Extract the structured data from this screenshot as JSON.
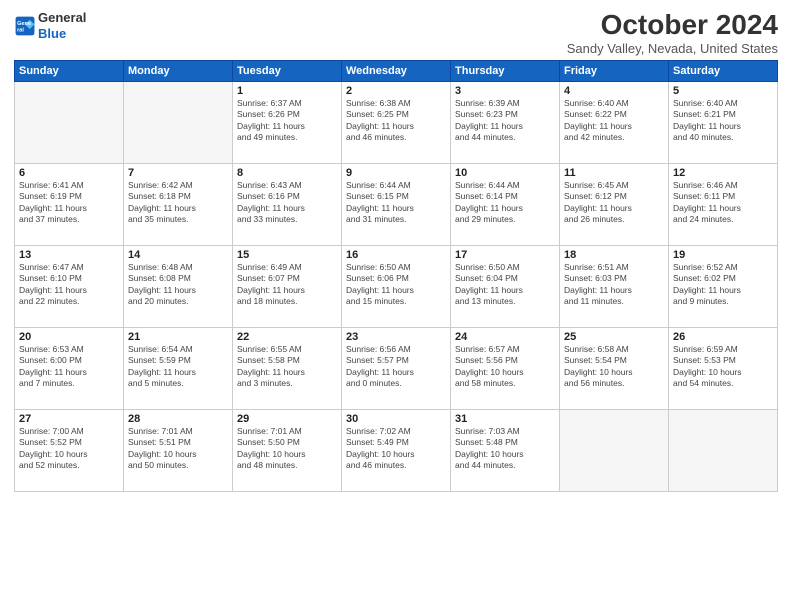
{
  "header": {
    "logo_line1": "General",
    "logo_line2": "Blue",
    "month": "October 2024",
    "location": "Sandy Valley, Nevada, United States"
  },
  "weekdays": [
    "Sunday",
    "Monday",
    "Tuesday",
    "Wednesday",
    "Thursday",
    "Friday",
    "Saturday"
  ],
  "weeks": [
    [
      {
        "day": "",
        "detail": ""
      },
      {
        "day": "",
        "detail": ""
      },
      {
        "day": "1",
        "detail": "Sunrise: 6:37 AM\nSunset: 6:26 PM\nDaylight: 11 hours\nand 49 minutes."
      },
      {
        "day": "2",
        "detail": "Sunrise: 6:38 AM\nSunset: 6:25 PM\nDaylight: 11 hours\nand 46 minutes."
      },
      {
        "day": "3",
        "detail": "Sunrise: 6:39 AM\nSunset: 6:23 PM\nDaylight: 11 hours\nand 44 minutes."
      },
      {
        "day": "4",
        "detail": "Sunrise: 6:40 AM\nSunset: 6:22 PM\nDaylight: 11 hours\nand 42 minutes."
      },
      {
        "day": "5",
        "detail": "Sunrise: 6:40 AM\nSunset: 6:21 PM\nDaylight: 11 hours\nand 40 minutes."
      }
    ],
    [
      {
        "day": "6",
        "detail": "Sunrise: 6:41 AM\nSunset: 6:19 PM\nDaylight: 11 hours\nand 37 minutes."
      },
      {
        "day": "7",
        "detail": "Sunrise: 6:42 AM\nSunset: 6:18 PM\nDaylight: 11 hours\nand 35 minutes."
      },
      {
        "day": "8",
        "detail": "Sunrise: 6:43 AM\nSunset: 6:16 PM\nDaylight: 11 hours\nand 33 minutes."
      },
      {
        "day": "9",
        "detail": "Sunrise: 6:44 AM\nSunset: 6:15 PM\nDaylight: 11 hours\nand 31 minutes."
      },
      {
        "day": "10",
        "detail": "Sunrise: 6:44 AM\nSunset: 6:14 PM\nDaylight: 11 hours\nand 29 minutes."
      },
      {
        "day": "11",
        "detail": "Sunrise: 6:45 AM\nSunset: 6:12 PM\nDaylight: 11 hours\nand 26 minutes."
      },
      {
        "day": "12",
        "detail": "Sunrise: 6:46 AM\nSunset: 6:11 PM\nDaylight: 11 hours\nand 24 minutes."
      }
    ],
    [
      {
        "day": "13",
        "detail": "Sunrise: 6:47 AM\nSunset: 6:10 PM\nDaylight: 11 hours\nand 22 minutes."
      },
      {
        "day": "14",
        "detail": "Sunrise: 6:48 AM\nSunset: 6:08 PM\nDaylight: 11 hours\nand 20 minutes."
      },
      {
        "day": "15",
        "detail": "Sunrise: 6:49 AM\nSunset: 6:07 PM\nDaylight: 11 hours\nand 18 minutes."
      },
      {
        "day": "16",
        "detail": "Sunrise: 6:50 AM\nSunset: 6:06 PM\nDaylight: 11 hours\nand 15 minutes."
      },
      {
        "day": "17",
        "detail": "Sunrise: 6:50 AM\nSunset: 6:04 PM\nDaylight: 11 hours\nand 13 minutes."
      },
      {
        "day": "18",
        "detail": "Sunrise: 6:51 AM\nSunset: 6:03 PM\nDaylight: 11 hours\nand 11 minutes."
      },
      {
        "day": "19",
        "detail": "Sunrise: 6:52 AM\nSunset: 6:02 PM\nDaylight: 11 hours\nand 9 minutes."
      }
    ],
    [
      {
        "day": "20",
        "detail": "Sunrise: 6:53 AM\nSunset: 6:00 PM\nDaylight: 11 hours\nand 7 minutes."
      },
      {
        "day": "21",
        "detail": "Sunrise: 6:54 AM\nSunset: 5:59 PM\nDaylight: 11 hours\nand 5 minutes."
      },
      {
        "day": "22",
        "detail": "Sunrise: 6:55 AM\nSunset: 5:58 PM\nDaylight: 11 hours\nand 3 minutes."
      },
      {
        "day": "23",
        "detail": "Sunrise: 6:56 AM\nSunset: 5:57 PM\nDaylight: 11 hours\nand 0 minutes."
      },
      {
        "day": "24",
        "detail": "Sunrise: 6:57 AM\nSunset: 5:56 PM\nDaylight: 10 hours\nand 58 minutes."
      },
      {
        "day": "25",
        "detail": "Sunrise: 6:58 AM\nSunset: 5:54 PM\nDaylight: 10 hours\nand 56 minutes."
      },
      {
        "day": "26",
        "detail": "Sunrise: 6:59 AM\nSunset: 5:53 PM\nDaylight: 10 hours\nand 54 minutes."
      }
    ],
    [
      {
        "day": "27",
        "detail": "Sunrise: 7:00 AM\nSunset: 5:52 PM\nDaylight: 10 hours\nand 52 minutes."
      },
      {
        "day": "28",
        "detail": "Sunrise: 7:01 AM\nSunset: 5:51 PM\nDaylight: 10 hours\nand 50 minutes."
      },
      {
        "day": "29",
        "detail": "Sunrise: 7:01 AM\nSunset: 5:50 PM\nDaylight: 10 hours\nand 48 minutes."
      },
      {
        "day": "30",
        "detail": "Sunrise: 7:02 AM\nSunset: 5:49 PM\nDaylight: 10 hours\nand 46 minutes."
      },
      {
        "day": "31",
        "detail": "Sunrise: 7:03 AM\nSunset: 5:48 PM\nDaylight: 10 hours\nand 44 minutes."
      },
      {
        "day": "",
        "detail": ""
      },
      {
        "day": "",
        "detail": ""
      }
    ]
  ]
}
